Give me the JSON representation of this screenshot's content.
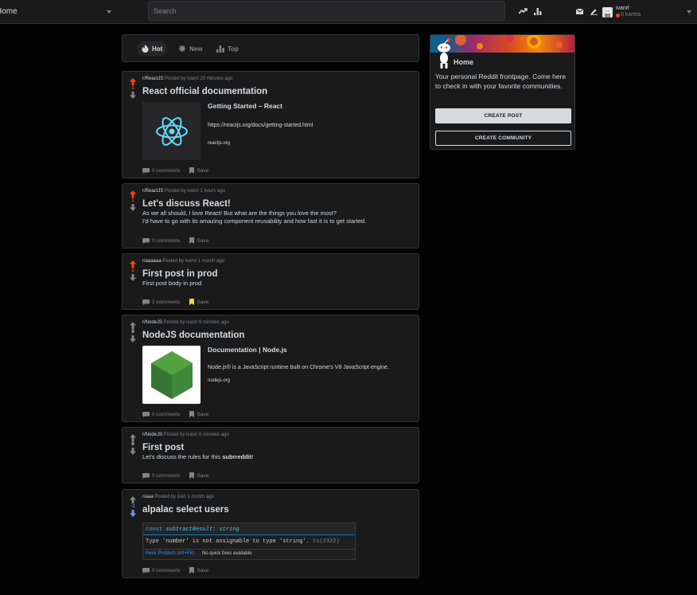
{
  "header": {
    "feed_label": "Home",
    "search_placeholder": "Search",
    "username": "ivanrl",
    "karma": "0 karma"
  },
  "sort": {
    "options": [
      {
        "label": "Hot",
        "active": true
      },
      {
        "label": "New",
        "active": false
      },
      {
        "label": "Top",
        "active": false
      }
    ]
  },
  "posts": [
    {
      "subreddit": "r/ReactJS",
      "meta": "Posted by ivanrl 20 minutes ago",
      "score": "1",
      "vote": "up",
      "title": "React official documentation",
      "link": {
        "title": "Getting Started – React",
        "description": "https://reactjs.org/docs/getting-started.html",
        "domain": "reactjs.org",
        "thumb_icon": "react-logo-icon"
      },
      "comments": "0 comments",
      "save": "Save",
      "saved": false
    },
    {
      "subreddit": "r/ReactJS",
      "meta": "Posted by ivanrl 1 hours ago",
      "score": "1",
      "vote": "up",
      "title": "Let's discuss React!",
      "body": [
        "As we all should, I love React! But what are the things you love the most?",
        "I'd have to go with its amazing component reusability and how fast it is to get started."
      ],
      "comments": "0 comments",
      "save": "Save",
      "saved": false
    },
    {
      "subreddit": "r/aaaaaa",
      "meta": "Posted by ivanrl 1 month ago",
      "score": "2",
      "vote": "up",
      "title": "First post in prod",
      "body": [
        "First post body in prod"
      ],
      "comments": "2 comments",
      "save": "Save",
      "saved": true
    },
    {
      "subreddit": "r/NodeJS",
      "meta": "Posted by ivanrl 6 minutes ago",
      "score": "0",
      "vote": "none",
      "title": "NodeJS documentation",
      "link": {
        "title": "Documentation | Node.js",
        "description": "Node.js® is a JavaScript runtime built on Chrome's V8 JavaScript engine.",
        "domain": "nodejs.org",
        "thumb_icon": "nodejs-logo-icon"
      },
      "comments": "0 comments",
      "save": "Save",
      "saved": false
    },
    {
      "subreddit": "r/NodeJS",
      "meta": "Posted by ivanrl 6 minutes ago",
      "score": "0",
      "vote": "none",
      "title": "First post",
      "body_prefix": "Let's discuss the rules for this ",
      "body_bold": "subrreddit",
      "body_suffix": "!",
      "comments": "0 comments",
      "save": "Save",
      "saved": false
    },
    {
      "subreddit": "r/aaa",
      "meta": "Posted by ivan 1 month ago",
      "score": "-1",
      "vote": "down",
      "title": "alpalac select users",
      "code": {
        "line1_kw": "const ",
        "line1_var": "subtractResult",
        "line1_colon": ": ",
        "line1_type": "string",
        "line2": "Type 'number' is not assignable to type 'string'.",
        "line2_code": "ts(2322)",
        "peek": "Peek Problem (Alt+F8)",
        "nofix": "No quick fixes available"
      },
      "comments": "0 comments",
      "save": "Save",
      "saved": false
    }
  ],
  "sidebar": {
    "title": "Home",
    "description": "Your personal Reddit frontpage. Come here to check in with your favorite communities.",
    "create_post": "CREATE POST",
    "create_community": "CREATE COMMUNITY"
  },
  "colors": {
    "upvote": "#ff4500",
    "downvote": "#7193ff",
    "saved": "#ffd635",
    "background": "#030303",
    "card": "#1a1a1b"
  }
}
